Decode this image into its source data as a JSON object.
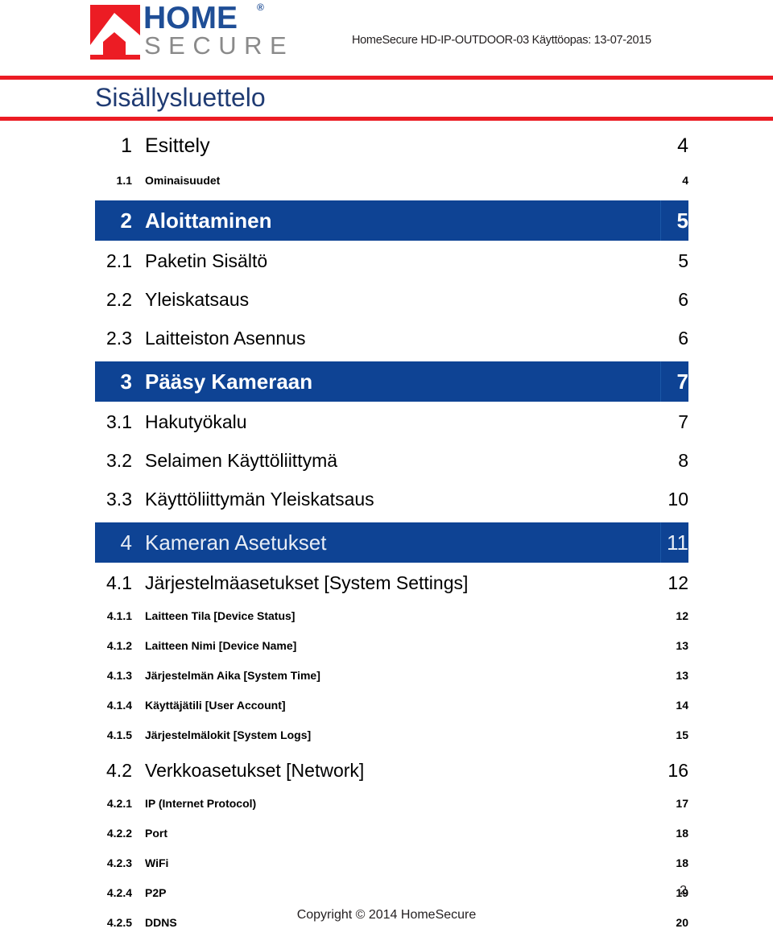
{
  "header": {
    "logo": {
      "mark": "house-arrow-mark",
      "home_text": "HOME",
      "registered_mark": "®",
      "secure_text": "SECURE",
      "red": "#EC1C24",
      "navy": "#1F4E96",
      "gray": "#8A8A8A"
    },
    "document_title": "HomeSecure HD-IP-OUTDOOR-03 Käyttöopas: 13-07-2015"
  },
  "page_title": "Sisällysluettelo",
  "colors": {
    "rule_red": "#EC1C24",
    "highlight_navy": "#0E4394",
    "title_navy": "#1F3B73"
  },
  "toc": {
    "entries": [
      {
        "level": 1,
        "highlight": false,
        "light": false,
        "number": "1",
        "label": "Esittely",
        "page": "4"
      },
      {
        "level": 3,
        "highlight": false,
        "light": false,
        "number": "1.1",
        "label": "Ominaisuudet",
        "page": "4"
      },
      {
        "level": 1,
        "highlight": true,
        "light": false,
        "number": "2",
        "label": "Aloittaminen",
        "page": "5"
      },
      {
        "level": 2,
        "highlight": false,
        "light": false,
        "number": "2.1",
        "label": "Paketin Sisältö",
        "page": "5"
      },
      {
        "level": 2,
        "highlight": false,
        "light": false,
        "number": "2.2",
        "label": "Yleiskatsaus",
        "page": "6"
      },
      {
        "level": 2,
        "highlight": false,
        "light": false,
        "number": "2.3",
        "label": "Laitteiston Asennus",
        "page": "6"
      },
      {
        "level": 1,
        "highlight": true,
        "light": false,
        "number": "3",
        "label": "Pääsy Kameraan",
        "page": "7"
      },
      {
        "level": 2,
        "highlight": false,
        "light": false,
        "number": "3.1",
        "label": "Hakutyökalu",
        "page": "7"
      },
      {
        "level": 2,
        "highlight": false,
        "light": false,
        "number": "3.2",
        "label": "Selaimen Käyttöliittymä",
        "page": "8"
      },
      {
        "level": 2,
        "highlight": false,
        "light": false,
        "number": "3.3",
        "label": "Käyttöliittymän Yleiskatsaus",
        "page": "10"
      },
      {
        "level": 1,
        "highlight": true,
        "light": true,
        "number": "4",
        "label": "Kameran Asetukset",
        "page": "11"
      },
      {
        "level": 2,
        "highlight": false,
        "light": false,
        "number": "4.1",
        "label": "Järjestelmäasetukset [System Settings]",
        "page": "12"
      },
      {
        "level": 3,
        "highlight": false,
        "light": false,
        "number": "4.1.1",
        "label": "Laitteen Tila [Device Status]",
        "page": "12"
      },
      {
        "level": 3,
        "highlight": false,
        "light": false,
        "number": "4.1.2",
        "label": "Laitteen Nimi [Device Name]",
        "page": "13"
      },
      {
        "level": 3,
        "highlight": false,
        "light": false,
        "number": "4.1.3",
        "label": "Järjestelmän Aika [System Time]",
        "page": "13"
      },
      {
        "level": 3,
        "highlight": false,
        "light": false,
        "number": "4.1.4",
        "label": "Käyttäjätili [User Account]",
        "page": "14"
      },
      {
        "level": 3,
        "highlight": false,
        "light": false,
        "number": "4.1.5",
        "label": "Järjestelmälokit [System Logs]",
        "page": "15"
      },
      {
        "level": 2,
        "highlight": false,
        "light": false,
        "number": "4.2",
        "label": "Verkkoasetukset [Network]",
        "page": "16"
      },
      {
        "level": 3,
        "highlight": false,
        "light": false,
        "number": "4.2.1",
        "label": "IP (Internet Protocol)",
        "page": "17"
      },
      {
        "level": 3,
        "highlight": false,
        "light": false,
        "number": "4.2.2",
        "label": "Port",
        "page": "18"
      },
      {
        "level": 3,
        "highlight": false,
        "light": false,
        "number": "4.2.3",
        "label": "WiFi",
        "page": "18"
      },
      {
        "level": 3,
        "highlight": false,
        "light": false,
        "number": "4.2.4",
        "label": "P2P",
        "page": "19"
      },
      {
        "level": 3,
        "highlight": false,
        "light": false,
        "number": "4.2.5",
        "label": "DDNS",
        "page": "20"
      }
    ]
  },
  "footer": {
    "copyright": "Copyright © 2014 HomeSecure",
    "page_number": "2"
  }
}
